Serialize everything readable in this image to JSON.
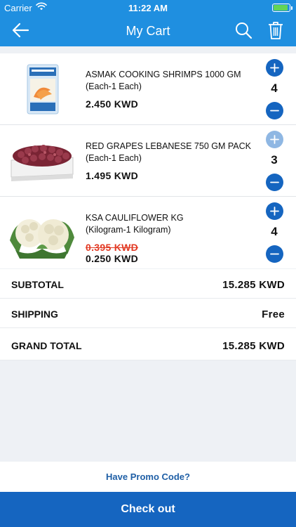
{
  "status_bar": {
    "carrier": "Carrier",
    "time": "11:22 AM"
  },
  "header": {
    "title": "My Cart",
    "back_icon": "arrow-left-icon",
    "search_icon": "search-icon",
    "delete_icon": "trash-icon"
  },
  "cart": {
    "items": [
      {
        "name": "ASMAK COOKING SHRIMPS 1000 GM",
        "unit": "(Each-1 Each)",
        "price": "2.450 KWD",
        "quantity": "4"
      },
      {
        "name": "RED GRAPES LEBANESE 750 GM PACK",
        "unit": "(Each-1 Each)",
        "price": "1.495 KWD",
        "quantity": "3"
      },
      {
        "name": "KSA CAULIFLOWER KG",
        "unit": "(Kilogram-1 Kilogram)",
        "old_price": "0.395 KWD",
        "price": "0.250 KWD",
        "quantity": "4"
      }
    ]
  },
  "totals": {
    "subtotal_label": "SUBTOTAL",
    "subtotal_value": "15.285 KWD",
    "shipping_label": "SHIPPING",
    "shipping_value": "Free",
    "grand_label": "GRAND TOTAL",
    "grand_value": "15.285 KWD"
  },
  "promo": {
    "label": "Have Promo Code?"
  },
  "checkout": {
    "label": "Check out"
  },
  "colors": {
    "header": "#1f8fe0",
    "accent": "#1565c0",
    "strike": "#e23b25",
    "background": "#eef1f5"
  }
}
